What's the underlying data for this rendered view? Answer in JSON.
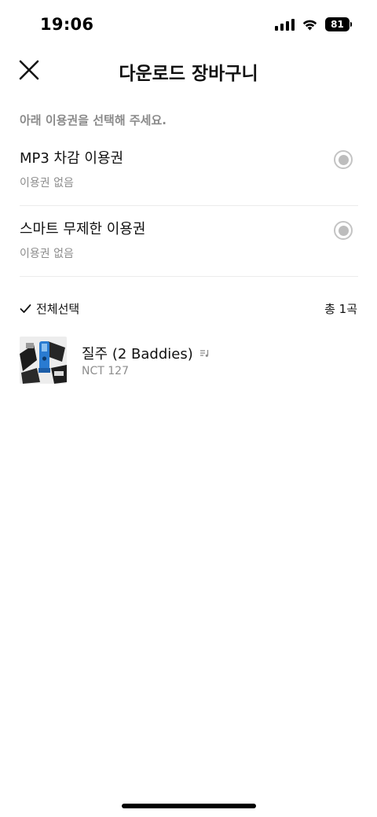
{
  "status_bar": {
    "time": "19:06",
    "battery": "81"
  },
  "header": {
    "title": "다운로드 장바구니"
  },
  "instruction": "아래 이용권을 선택해 주세요.",
  "options": [
    {
      "title": "MP3 차감 이용권",
      "subtitle": "이용권 없음"
    },
    {
      "title": "스마트 무제한 이용권",
      "subtitle": "이용권 없음"
    }
  ],
  "list_header": {
    "select_all": "전체선택",
    "total": "총 1곡"
  },
  "tracks": [
    {
      "title": "질주 (2 Baddies)",
      "artist": "NCT 127"
    }
  ],
  "colors": {
    "muted_text": "#8d8d8d",
    "radio": "#bdbdbd",
    "divider": "#ececec"
  }
}
